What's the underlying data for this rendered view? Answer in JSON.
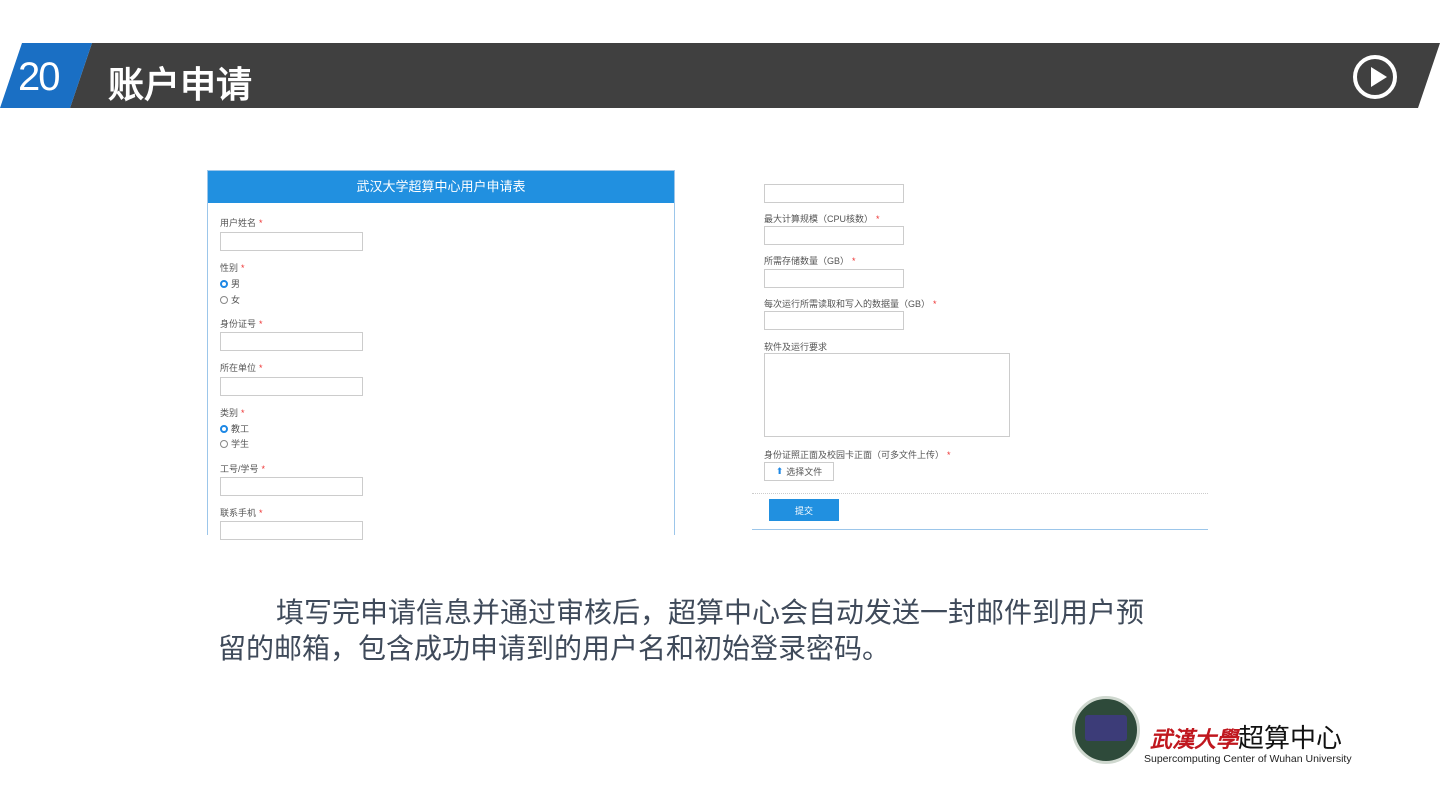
{
  "header": {
    "number": "20",
    "title": "账户申请",
    "play_icon": "play-circle-icon"
  },
  "left_form": {
    "title": "武汉大学超算中心用户申请表",
    "fields": {
      "name": "用户姓名",
      "gender": "性别",
      "male": "男",
      "female": "女",
      "id": "身份证号",
      "unit": "所在单位",
      "category": "类别",
      "staff": "教工",
      "student": "学生",
      "staff_id": "工号/学号",
      "phone": "联系手机"
    },
    "required": "*"
  },
  "right_form": {
    "cpu": "最大计算规模（CPU核数）",
    "storage": "所需存储数量（GB）",
    "io": "每次运行所需读取和写入的数据量（GB）",
    "software": "软件及运行要求",
    "upload_label": "身份证照正面及校园卡正面（可多文件上传）",
    "upload_button": "选择文件",
    "submit": "提交",
    "required": "*"
  },
  "description": "填写完申请信息并通过审核后，超算中心会自动发送一封邮件到用户预留的邮箱，包含成功申请到的用户名和初始登录密码。",
  "logo": {
    "cn_script": "武漢大學",
    "cn": "超算中心",
    "en": "Supercomputing Center of Wuhan University"
  }
}
